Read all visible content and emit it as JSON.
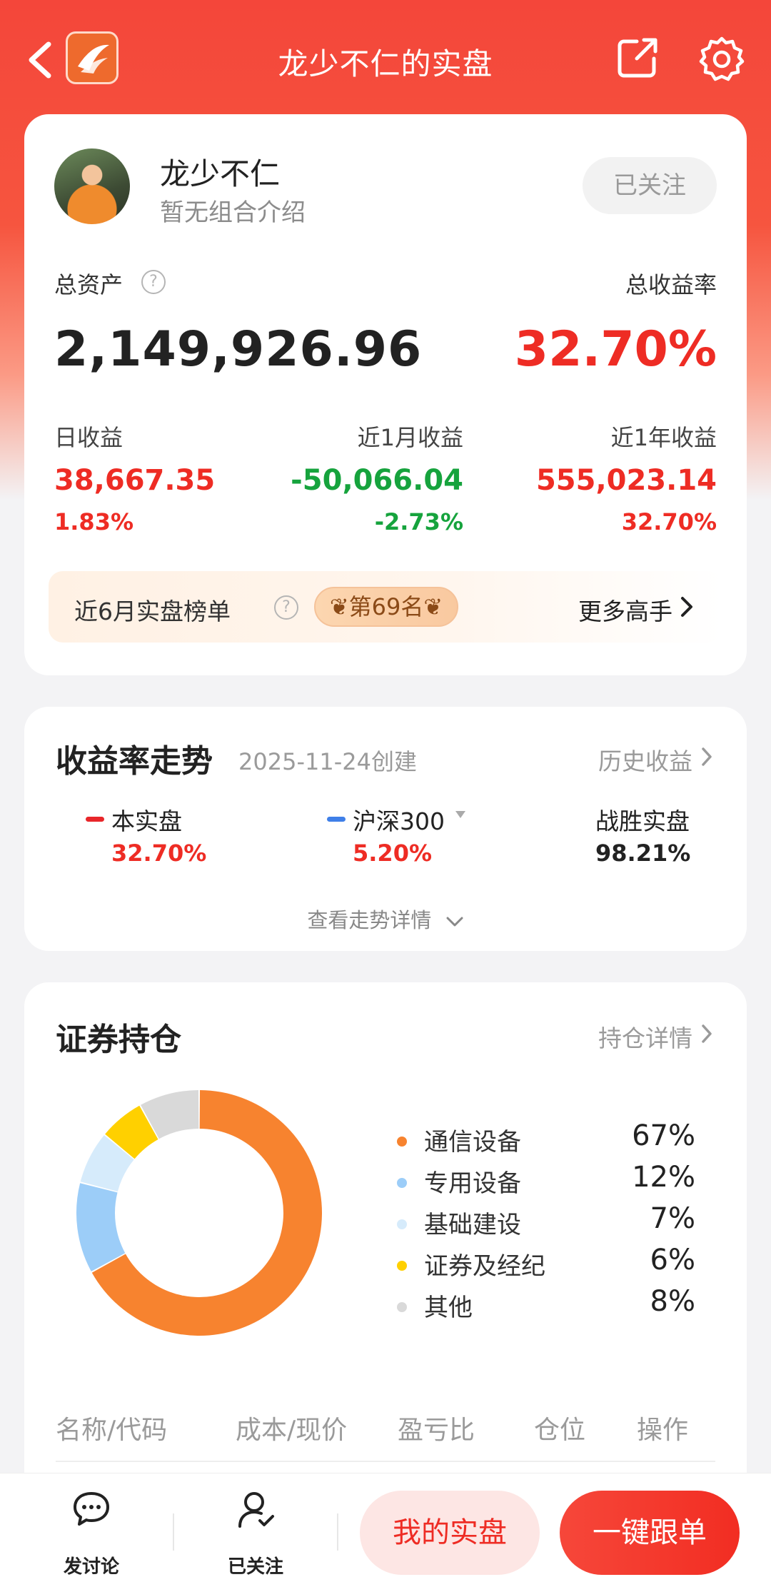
{
  "header": {
    "title": "龙少不仁的实盘"
  },
  "profile": {
    "nickname": "龙少不仁",
    "intro": "暂无组合介绍",
    "follow_label": "已关注"
  },
  "assets": {
    "total_label": "总资产",
    "total_value": "2,149,926.96",
    "return_label": "总收益率",
    "return_value": "32.70%"
  },
  "stats": [
    {
      "label": "日收益",
      "value": "38,667.35",
      "pct": "1.83%",
      "color": "#ee2c24"
    },
    {
      "label": "近1月收益",
      "value": "-50,066.04",
      "pct": "-2.73%",
      "color": "#16a33d"
    },
    {
      "label": "近1年收益",
      "value": "555,023.14",
      "pct": "32.70%",
      "color": "#ee2c24"
    }
  ],
  "rank": {
    "label": "近6月实盘榜单",
    "badge": "第69名",
    "more": "更多高手"
  },
  "trend": {
    "title": "收益率走势",
    "created": "2025-11-24创建",
    "history_link": "历史收益",
    "series": [
      {
        "name": "本实盘",
        "value": "32.70%",
        "color": "#e8262a"
      },
      {
        "name": "沪深300",
        "value": "5.20%",
        "color": "#3f7fe8"
      },
      {
        "name": "战胜实盘",
        "value": "98.21%"
      }
    ],
    "expand_label": "查看走势详情"
  },
  "holdings": {
    "title": "证券持仓",
    "detail_link": "持仓详情",
    "columns": [
      "名称/代码",
      "成本/现价",
      "盈亏比",
      "仓位",
      "操作"
    ]
  },
  "chart_data": {
    "type": "pie",
    "categories": [
      "通信设备",
      "专用设备",
      "基础建设",
      "证券及经纪",
      "其他"
    ],
    "values": [
      67,
      12,
      7,
      6,
      8
    ],
    "labels": [
      "67%",
      "12%",
      "7%",
      "6%",
      "8%"
    ],
    "colors": [
      "#f7832f",
      "#9ccdf8",
      "#d6ebfb",
      "#ffd000",
      "#d9d9d9"
    ],
    "legend_position": "right"
  },
  "bottom": {
    "discuss": "发讨论",
    "followed": "已关注",
    "mine": "我的实盘",
    "copy": "一键跟单"
  }
}
